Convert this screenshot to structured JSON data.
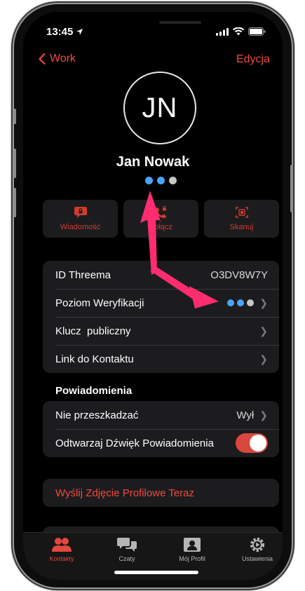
{
  "status_bar": {
    "time": "13:45"
  },
  "nav": {
    "back_label": "Work",
    "edit_label": "Edycja"
  },
  "profile": {
    "initials": "JN",
    "name": "Jan Nowak"
  },
  "actions": [
    {
      "label": "Wiadomość",
      "icon": "message-lock-icon"
    },
    {
      "label": "Połącz",
      "icon": "call-lock-icon"
    },
    {
      "label": "Skanuj",
      "icon": "scan-qr-icon"
    }
  ],
  "details": {
    "id_label": "ID Threema",
    "id_value": "O3DV8W7Y",
    "verification_label": "Poziom Weryfikacji",
    "public_key_label": "Klucz  publiczny",
    "contact_link_label": "Link do Kontaktu"
  },
  "notifications": {
    "section_title": "Powiadomienia",
    "dnd_label": "Nie przeszkadzać",
    "dnd_value": "Wył",
    "sound_label": "Odtwarzaj Dźwięk Powiadomienia",
    "sound_on": true
  },
  "send_photo_label": "Wyślij Zdjęcie Profilowe Teraz",
  "tabs": [
    {
      "label": "Kontakty",
      "active": true
    },
    {
      "label": "Czaty",
      "active": false
    },
    {
      "label": "Mój Profil",
      "active": false
    },
    {
      "label": "Ustawienia",
      "active": false
    }
  ],
  "colors": {
    "accent": "#ef4b3f",
    "dot_blue": "#4aa3ff",
    "dot_gray": "#c7c7c7",
    "arrow": "#ff2d6f"
  }
}
